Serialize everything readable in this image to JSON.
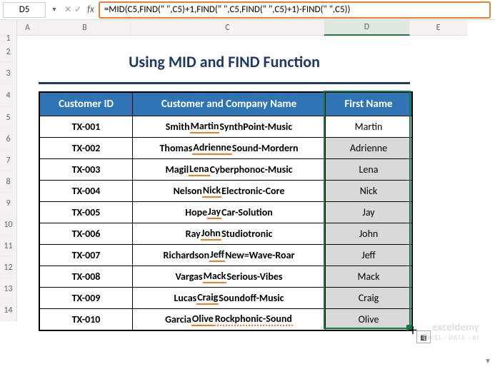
{
  "nameBox": "D5",
  "formula": "=MID(C5,FIND(\" \",C5)+1,FIND(\" \",C5,FIND(\" \",C5)+1)-FIND(\" \",C5))",
  "columns": [
    "A",
    "B",
    "C",
    "D",
    "E"
  ],
  "rowNums": [
    "1",
    "2",
    "3",
    "4",
    "5",
    "6",
    "7",
    "8",
    "9",
    "10",
    "11",
    "12",
    "13",
    "14"
  ],
  "title": "Using MID and FIND Function",
  "headers": {
    "b": "Customer ID",
    "c": "Customer and Company Name",
    "d": "First Name"
  },
  "rows": [
    {
      "id": "TX-001",
      "pre": "Smith ",
      "mid": "Martin",
      "post": " SynthPoint-Music",
      "comp": "SynthPoint-Music",
      "first": "Martin",
      "und": 1
    },
    {
      "id": "TX-002",
      "pre": "Thomas ",
      "mid": "Adrienne",
      "post": " Sound-Mordern",
      "comp": "Sound-Mordern",
      "first": "Adrienne",
      "und": 1
    },
    {
      "id": "TX-003",
      "pre": "Magil ",
      "mid": "Lena",
      "post": " Cyberphonoc-Music",
      "comp": "Cyberphonoc-Music",
      "first": "Lena",
      "und": 1
    },
    {
      "id": "TX-004",
      "pre": "Nelson ",
      "mid": "Nick",
      "post": " Electronic-Core",
      "comp": "Electronic-Core",
      "first": "Nick",
      "und": 1
    },
    {
      "id": "TX-005",
      "pre": "Hope ",
      "mid": "Jay",
      "post": " Car-Solution",
      "comp": "Car-Solution",
      "first": "Jay",
      "und": 1
    },
    {
      "id": "TX-006",
      "pre": "Ray ",
      "mid": "John",
      "post": " Studiotronic",
      "comp": "Studiotronic",
      "first": "John",
      "und": 1
    },
    {
      "id": "TX-007",
      "pre": "Richardson ",
      "mid": "Jeff",
      "post": " New=Wave-Roar",
      "comp": "New=Wave-Roar",
      "first": "Jeff",
      "und": 1
    },
    {
      "id": "TX-008",
      "pre": "Vargas ",
      "mid": "Mack",
      "post": " Serious-Vibes",
      "comp": "Serious-Vibes",
      "first": "Mack",
      "und": 1
    },
    {
      "id": "TX-009",
      "pre": "Lucas ",
      "mid": "Craig",
      "post": " Soundoff-Music",
      "comp": "Soundoff-Music",
      "first": "Craig",
      "und": 1
    },
    {
      "id": "TX-010",
      "pre": "Garcia ",
      "mid": "Olive",
      "post": " ",
      "comp": "Rockphonic-Sound",
      "first": "Olive",
      "und": 1,
      "compUnd": 2
    }
  ],
  "watermark": {
    "line1": "exceldemy",
    "line2": "EXCEL · DATA · BI"
  }
}
